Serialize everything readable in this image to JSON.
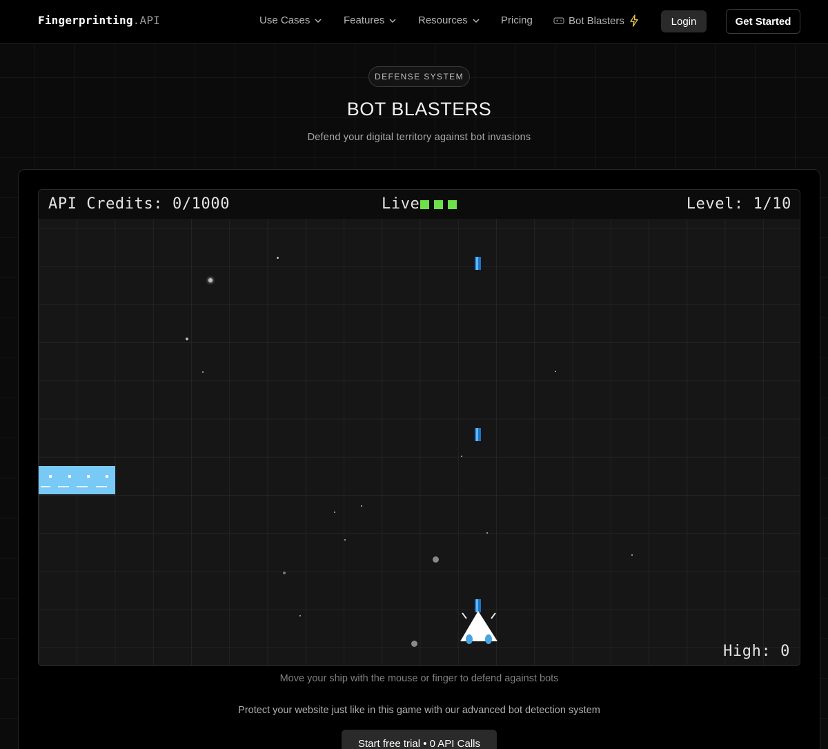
{
  "nav": {
    "logo_brand": "Fingerprinting",
    "logo_suffix": ".API",
    "use_cases": "Use Cases",
    "features": "Features",
    "resources": "Resources",
    "pricing": "Pricing",
    "bot_blasters": "Bot Blasters",
    "login": "Login",
    "get_started": "Get Started"
  },
  "hero": {
    "badge": "DEFENSE SYSTEM",
    "title": "BOT BLASTERS",
    "subtitle": "Defend your digital territory against bot invasions"
  },
  "game": {
    "credits_label": "API Credits: 0/1000",
    "lives_label": "Live",
    "lives_count": 3,
    "level_label": "Level: 1/10",
    "high_label": "High: 0"
  },
  "footer": {
    "hint": "Move your ship with the mouse or finger to defend against bots",
    "protect": "Protect your website just like in this game with our advanced bot detection system",
    "cta": "Start free trial • 0 API Calls"
  },
  "colors": {
    "life": "#6ee14a",
    "bullet": "#5cb8f2",
    "bot": "#78c9f6",
    "bolt": "#e8c548"
  }
}
